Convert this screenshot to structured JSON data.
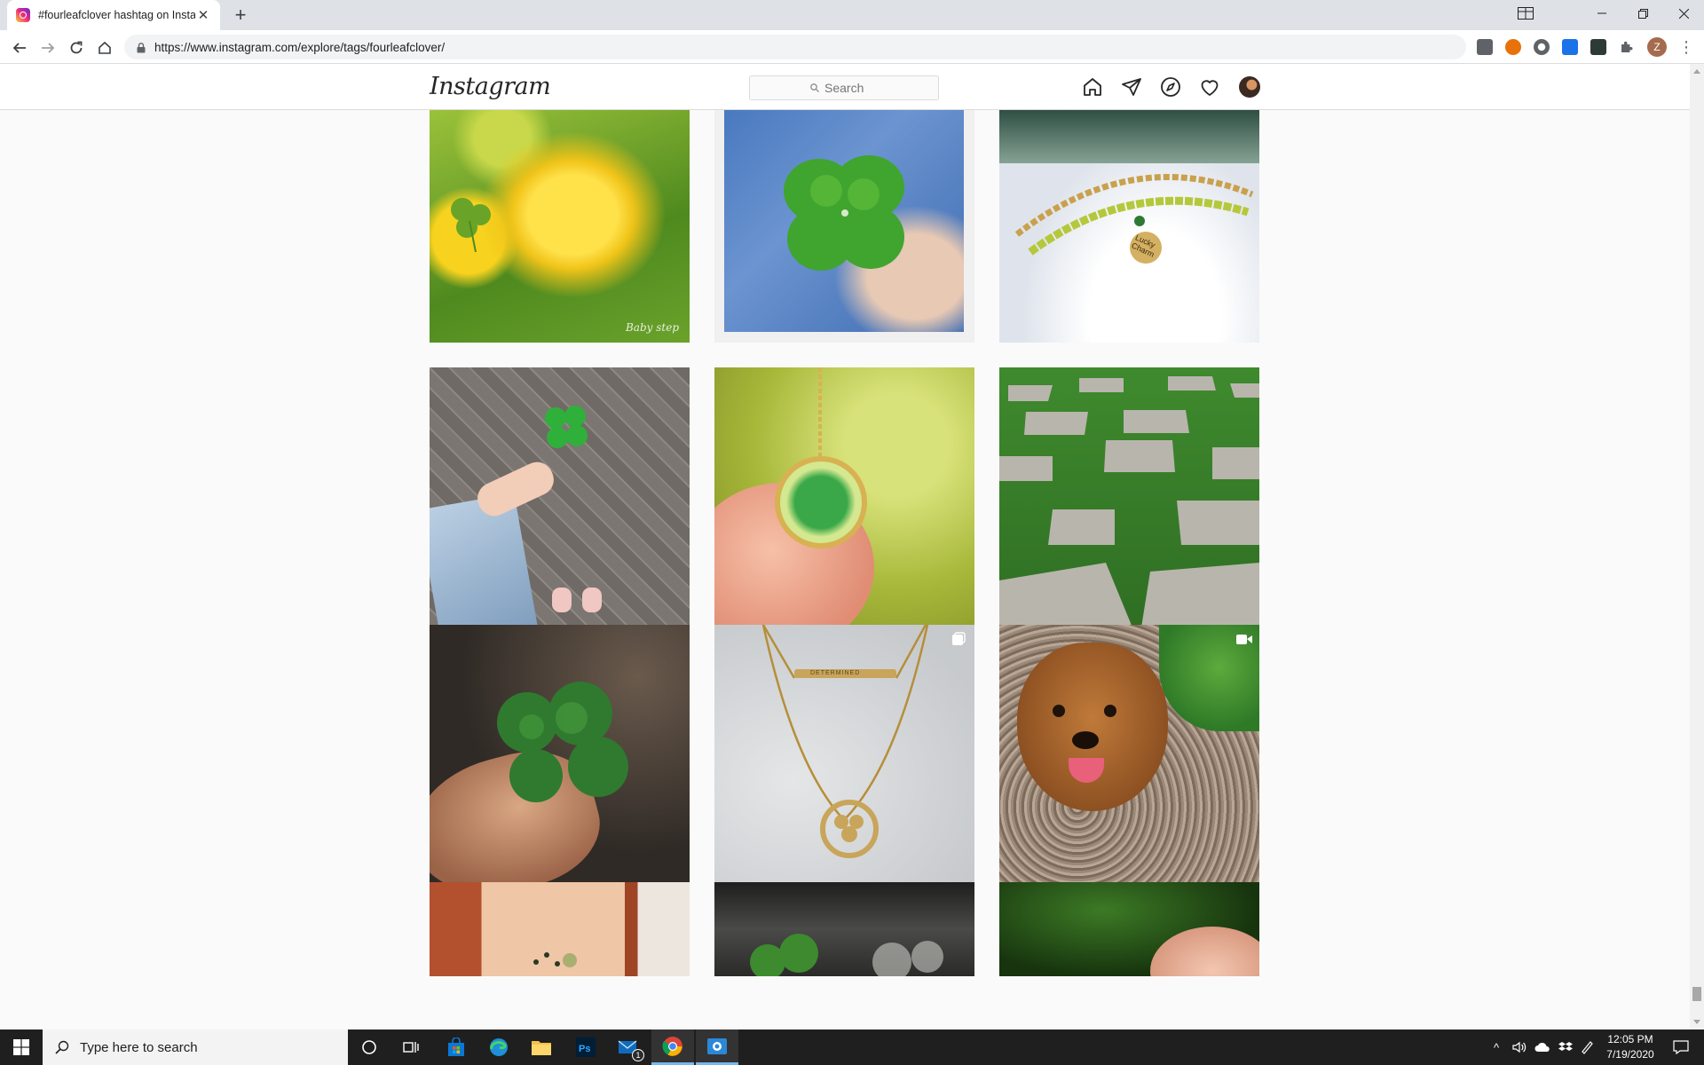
{
  "browser": {
    "tab_title": "#fourleafclover hashtag on Instagram",
    "url": "https://www.instagram.com/explore/tags/fourleafclover/",
    "profile_initial": "Z"
  },
  "instagram": {
    "logo_text": "Instagram",
    "search_placeholder": "Search"
  },
  "grid": {
    "tiles": [
      {
        "label": "yellow-marigold-clover",
        "overlay_text": "Baby step"
      },
      {
        "label": "four-leaf-clover-in-hand"
      },
      {
        "label": "lucky-charm-bracelet",
        "overlay_text": "Lucky Charm"
      },
      {
        "label": "clover-held-over-pavement"
      },
      {
        "label": "clover-resin-pendant"
      },
      {
        "label": "grass-checker-pavers"
      },
      {
        "label": "clover-in-hand-dark"
      },
      {
        "label": "determined-necklace",
        "overlay_text": "DETERMINED",
        "badge": "multiple-posts-icon"
      },
      {
        "label": "brown-dog-in-clover",
        "badge": "video-icon"
      },
      {
        "label": "arm-tattoo"
      },
      {
        "label": "clover-on-dark-wood"
      },
      {
        "label": "hand-green-blur"
      }
    ]
  },
  "taskbar": {
    "search_placeholder": "Type here to search",
    "mail_badge": "1",
    "time": "12:05 PM",
    "date": "7/19/2020"
  }
}
